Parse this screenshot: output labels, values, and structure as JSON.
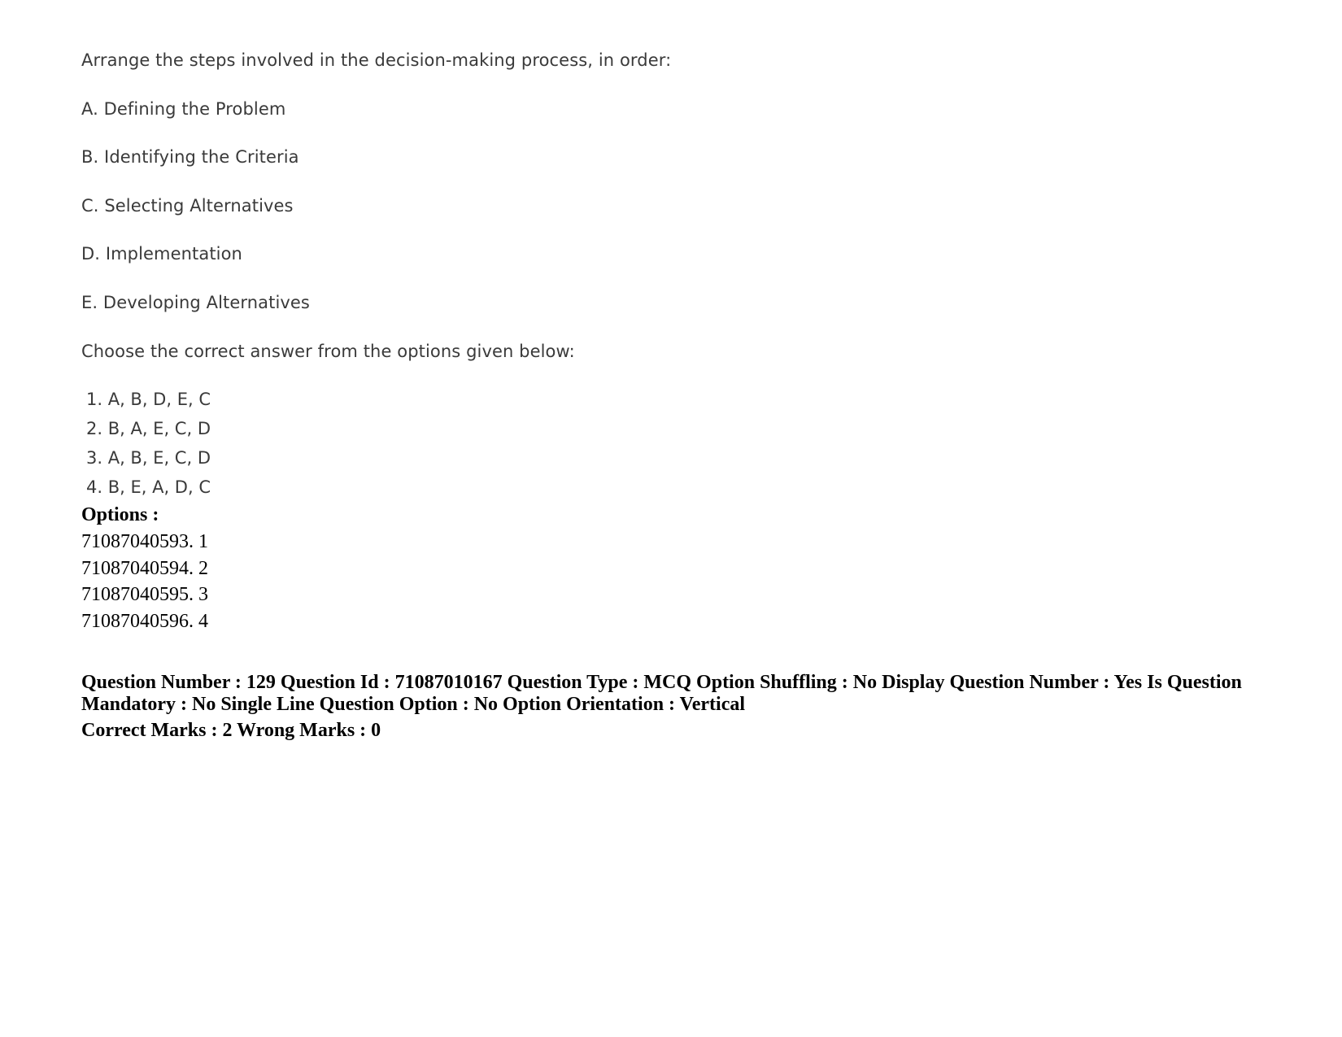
{
  "question": {
    "stem": "Arrange the steps involved in the decision-making process, in order:",
    "items": [
      "A. Defining the Problem",
      "B. Identifying the Criteria",
      "C. Selecting Alternatives",
      "D. Implementation",
      "E. Developing Alternatives"
    ],
    "instruction": "Choose the correct answer from the options given below:",
    "answers": [
      "1. A, B, D, E, C",
      "2. B, A, E, C, D",
      "3. A, B, E, C, D",
      "4. B, E, A, D, C"
    ]
  },
  "options": {
    "heading": "Options :",
    "list": [
      "71087040593. 1",
      "71087040594. 2",
      "71087040595. 3",
      "71087040596. 4"
    ]
  },
  "next_question": {
    "meta": "Question Number : 129 Question Id : 71087010167 Question Type : MCQ Option Shuffling : No Display Question Number : Yes Is Question Mandatory : No Single Line Question Option : No Option Orientation : Vertical",
    "marks": "Correct Marks : 2 Wrong Marks : 0"
  }
}
